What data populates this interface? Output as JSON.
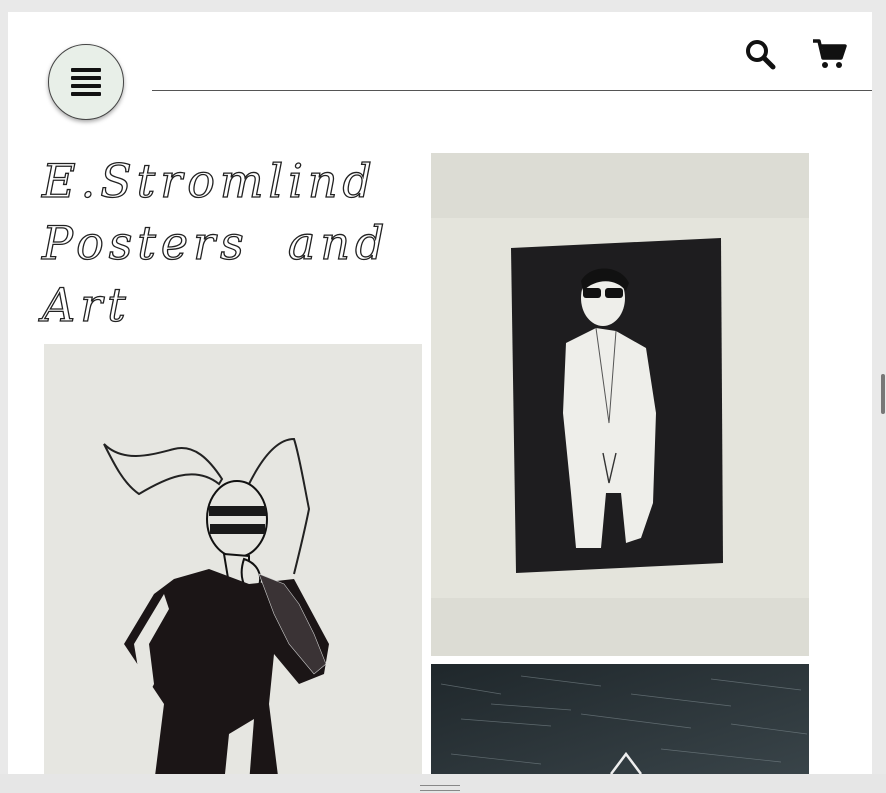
{
  "header": {
    "menu_icon": "hamburger-icon",
    "search_icon": "search-icon",
    "cart_icon": "shopping-cart-icon"
  },
  "logo": {
    "lines": [
      "E.Stromlind",
      "Posters  and",
      "Art"
    ]
  },
  "gallery": [
    {
      "name": "horned-figure-artwork",
      "description_hidden": true
    },
    {
      "name": "sunglasses-figure-artwork",
      "description_hidden": true
    },
    {
      "name": "dark-water-artwork",
      "description_hidden": true
    }
  ],
  "colors": {
    "menu_button_bg": "#e8efe8",
    "page_bg": "#ffffff",
    "ink": "#111111"
  }
}
